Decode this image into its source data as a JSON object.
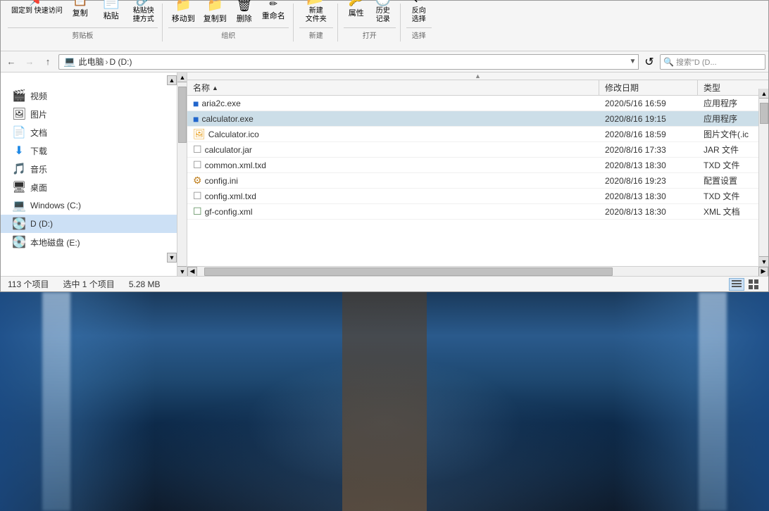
{
  "window": {
    "title": "D (D:)"
  },
  "ribbon": {
    "groups": [
      {
        "name": "clipboard",
        "label": "剪贴板",
        "buttons": [
          {
            "id": "pin",
            "icon": "📌",
            "label": "固定到\n快速访问"
          },
          {
            "id": "copy",
            "icon": "📋",
            "label": "复制"
          },
          {
            "id": "paste",
            "icon": "📄",
            "label": "粘贴"
          },
          {
            "id": "paste-shortcut",
            "icon": "🔗",
            "label": "粘贴快捷方式"
          }
        ]
      },
      {
        "name": "organize",
        "label": "组织",
        "buttons": [
          {
            "id": "move-to",
            "icon": "📁",
            "label": "移动到"
          },
          {
            "id": "copy-to",
            "icon": "📁",
            "label": "复制到"
          },
          {
            "id": "delete",
            "icon": "🗑",
            "label": "删除"
          },
          {
            "id": "rename",
            "icon": "✏",
            "label": "重命名"
          }
        ]
      },
      {
        "name": "new",
        "label": "新建",
        "buttons": [
          {
            "id": "new-folder",
            "icon": "📂",
            "label": "新建\n文件夹"
          }
        ]
      },
      {
        "name": "open",
        "label": "打开",
        "buttons": [
          {
            "id": "properties",
            "icon": "🔑",
            "label": "属性"
          },
          {
            "id": "history",
            "icon": "🕐",
            "label": "历史记录"
          }
        ]
      },
      {
        "name": "select",
        "label": "选择",
        "buttons": [
          {
            "id": "reverse-select",
            "icon": "↩",
            "label": "反向选择"
          }
        ]
      }
    ]
  },
  "addressbar": {
    "back_tooltip": "后退",
    "forward_tooltip": "前进",
    "up_tooltip": "向上",
    "path": [
      {
        "label": "此电脑"
      },
      {
        "sep": "›"
      },
      {
        "label": "D (D:)"
      }
    ],
    "refresh_tooltip": "刷新",
    "search_placeholder": "搜索\"D (D..."
  },
  "sidebar": {
    "items": [
      {
        "icon": "🎬",
        "label": "视频",
        "selected": false
      },
      {
        "icon": "🖼",
        "label": "图片",
        "selected": false
      },
      {
        "icon": "📄",
        "label": "文档",
        "selected": false
      },
      {
        "icon": "⬇",
        "label": "下载",
        "selected": false
      },
      {
        "icon": "🎵",
        "label": "音乐",
        "selected": false
      },
      {
        "icon": "🖥",
        "label": "桌面",
        "selected": false
      },
      {
        "icon": "💻",
        "label": "Windows (C:)",
        "selected": false
      },
      {
        "icon": "💽",
        "label": "D (D:)",
        "selected": true
      },
      {
        "icon": "💽",
        "label": "本地磁盘 (E:)",
        "selected": false
      }
    ]
  },
  "file_list": {
    "columns": {
      "name": "名称",
      "date": "修改日期",
      "type": "类型"
    },
    "files": [
      {
        "icon": "🔵",
        "name": "aria2c.exe",
        "date": "2020/5/16 16:59",
        "type": "应用程序",
        "selected": false
      },
      {
        "icon": "🔵",
        "name": "calculator.exe",
        "date": "2020/8/16 19:15",
        "type": "应用程序",
        "selected": true
      },
      {
        "icon": "🟡",
        "name": "Calculator.ico",
        "date": "2020/8/16 18:59",
        "type": "图片文件(.ic",
        "selected": false
      },
      {
        "icon": "⬜",
        "name": "calculator.jar",
        "date": "2020/8/16 17:33",
        "type": "JAR 文件",
        "selected": false
      },
      {
        "icon": "⬜",
        "name": "common.xml.txd",
        "date": "2020/8/13 18:30",
        "type": "TXD 文件",
        "selected": false
      },
      {
        "icon": "🔶",
        "name": "config.ini",
        "date": "2020/8/16 19:23",
        "type": "配置设置",
        "selected": false
      },
      {
        "icon": "⬜",
        "name": "config.xml.txd",
        "date": "2020/8/13 18:30",
        "type": "TXD 文件",
        "selected": false
      },
      {
        "icon": "⬜",
        "name": "gf-config.xml",
        "date": "2020/8/13 18:30",
        "type": "XML 文档",
        "selected": false
      }
    ]
  },
  "statusbar": {
    "item_count": "113 个项目",
    "selected_count": "选中 1 个项目",
    "selected_size": "5.28 MB"
  }
}
